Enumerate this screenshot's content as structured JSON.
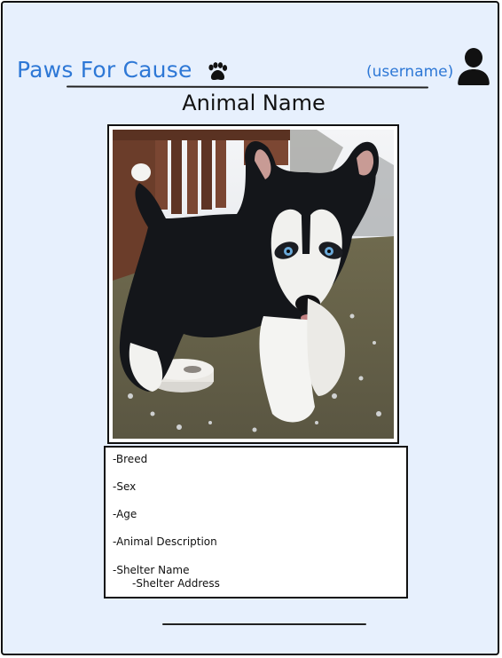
{
  "header": {
    "brand": "Paws For Cause",
    "brand_icon": "paw-icon",
    "username": "(username)",
    "user_icon": "user-icon"
  },
  "colors": {
    "background": "#e7f0fd",
    "accent": "#2e78d6",
    "border": "#111111"
  },
  "animal": {
    "name": "Animal Name",
    "photo_subject": "husky puppy",
    "details": {
      "breed": "-Breed",
      "sex": "-Sex",
      "age": "-Age",
      "description": "-Animal Description",
      "shelter_name": "-Shelter Name",
      "shelter_address": "-Shelter Address"
    }
  }
}
